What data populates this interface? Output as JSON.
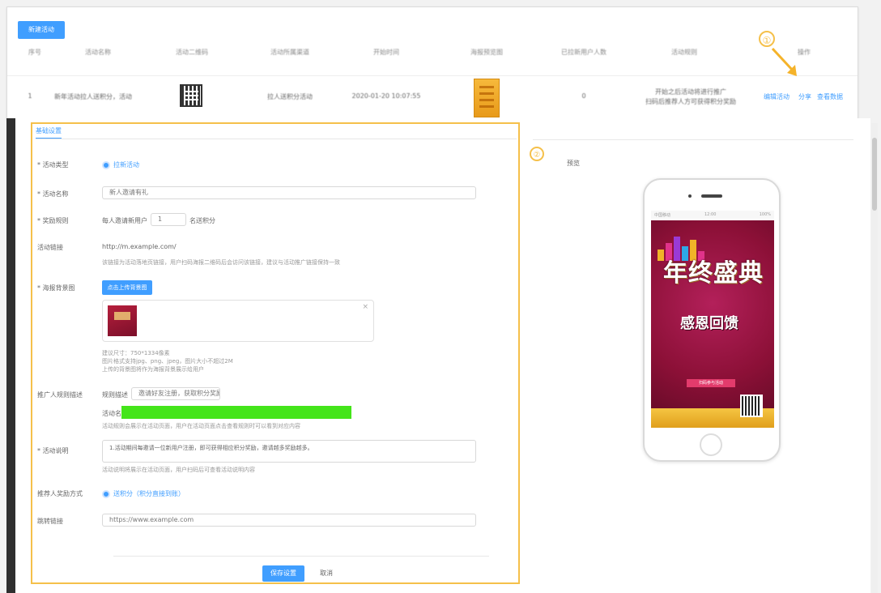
{
  "top_table": {
    "new_button": "新建活动",
    "columns": [
      "序号",
      "活动名称",
      "活动二维码",
      "活动所属渠道",
      "开始时间",
      "海报预览图",
      "已拉新用户人数",
      "活动规则",
      "①",
      "操作"
    ],
    "row": {
      "index": "1",
      "name": "新年活动拉人送积分，活动",
      "channel": "拉人送积分活动",
      "start_time": "2020-01-20 10:07:55",
      "new_users": "0",
      "status_line1": "开始之后活动将进行推广",
      "status_line2": "扫码后推荐人方可获得积分奖励",
      "ops": [
        "编辑活动",
        "分享",
        "查看数据"
      ]
    }
  },
  "form": {
    "tab": "基础设置",
    "rows": [
      {
        "label": "* 活动类型",
        "radio": "拉新活动"
      },
      {
        "label": "* 活动名称",
        "input": "新人邀请有礼"
      },
      {
        "label": "* 奖励规则",
        "prefix": "每人邀请新用户",
        "value": "1",
        "suffix": "名送积分"
      },
      {
        "label": "活动链接",
        "text": "http://m.example.com/",
        "hint": "该链接为活动落地页链接，用户扫码海报二维码后会访问该链接，建议与活动推广链接保持一致"
      },
      {
        "label": "* 海报背景图",
        "upload": "点击上传背景图"
      },
      {
        "label": "推广人规则描述",
        "desc_label": "规则描述",
        "desc_value": "邀请好友注册，获取积分奖励",
        "name_label": "活动名称",
        "hint": "活动规则会展示在活动页面，用户在活动页面点击查看规则时可以看到对应内容"
      },
      {
        "label": "* 活动说明",
        "textarea": "1.活动期间每邀请一位新用户注册，即可获得相应积分奖励，邀请越多奖励越多。"
      },
      {
        "label": "推荐人奖励方式",
        "radio": "送积分（积分直接到账）"
      },
      {
        "label": "跳转链接",
        "input": "https://www.example.com"
      }
    ],
    "upload_hints": [
      "建议尺寸：750*1334像素",
      "图片格式支持jpg、png、jpeg，图片大小不超过2M",
      "上传的背景图将作为海报背景展示给用户"
    ],
    "textarea_hint": "活动说明将展示在活动页面，用户扫码后可查看活动说明内容",
    "save": "保存设置",
    "cancel": "取消"
  },
  "preview": {
    "annotation": "②",
    "label": "预览",
    "poster_title": "年终盛典",
    "poster_sub": "感恩回馈",
    "poster_tag": "扫码参与活动",
    "status_left": "中国移动",
    "status_mid": "12:00",
    "status_right": "100%"
  },
  "colors": {
    "primary": "#409eff",
    "annotation": "#f5c04a",
    "highlight_green": "#44e51a",
    "poster_bg": "#8c1037"
  }
}
